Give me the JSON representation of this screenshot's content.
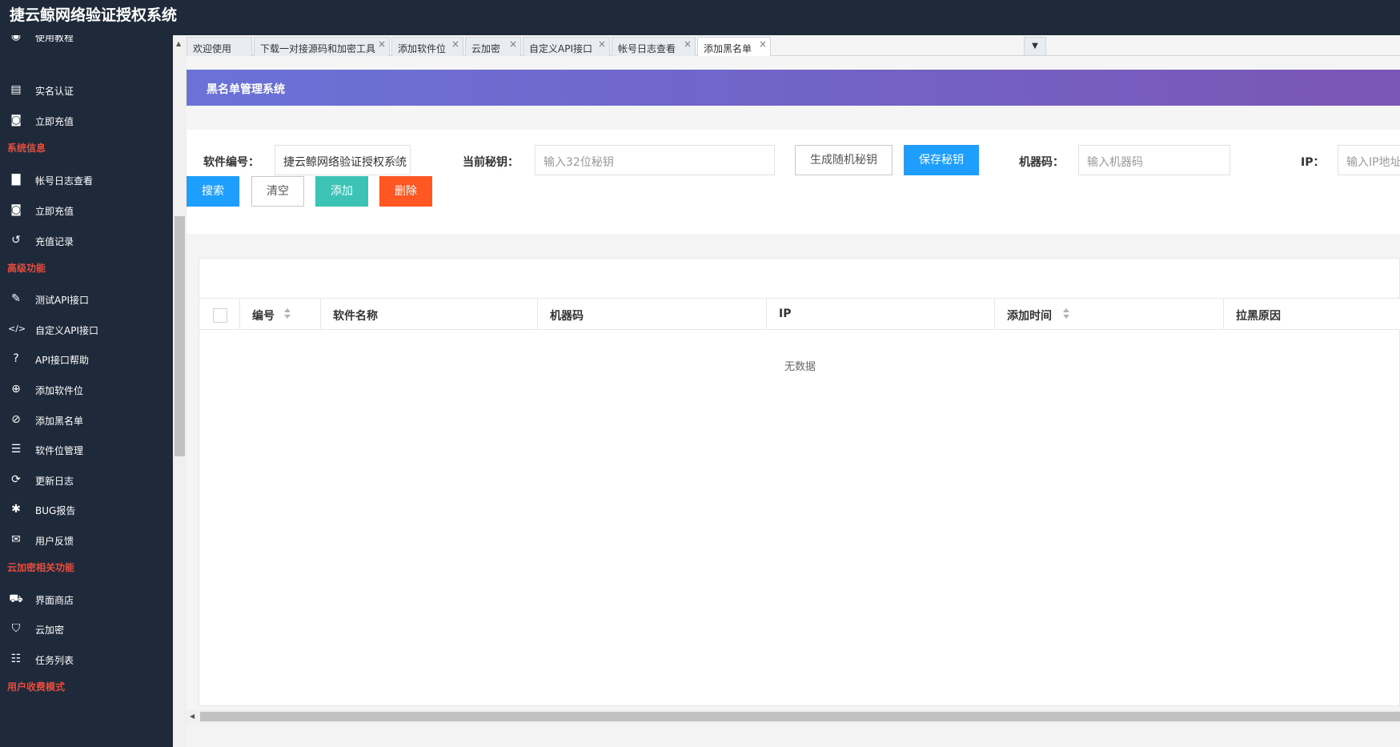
{
  "app": {
    "title": "捷云鲸网络验证授权系统"
  },
  "sidebar": {
    "partial_item": "使用教程",
    "items": [
      {
        "label": "实名认证",
        "icon": "id-card-icon",
        "glyph": "▤"
      },
      {
        "label": "立即充值",
        "icon": "money-icon",
        "glyph": "◙"
      },
      {
        "section": "系统信息"
      },
      {
        "label": "帐号日志查看",
        "icon": "file-icon",
        "glyph": "▇"
      },
      {
        "label": "立即充值",
        "icon": "money-icon",
        "glyph": "◙"
      },
      {
        "label": "充值记录",
        "icon": "history-icon",
        "glyph": "↺"
      },
      {
        "section": "高级功能"
      },
      {
        "label": "测试API接口",
        "icon": "plug-icon",
        "glyph": "✎"
      },
      {
        "label": "自定义API接口",
        "icon": "code-icon",
        "glyph": "</>"
      },
      {
        "label": "API接口帮助",
        "icon": "question-icon",
        "glyph": "?"
      },
      {
        "label": "添加软件位",
        "icon": "plus-circle-icon",
        "glyph": "⊕"
      },
      {
        "label": "添加黑名单",
        "icon": "ban-icon",
        "glyph": "⊘"
      },
      {
        "label": "软件位管理",
        "icon": "list-icon",
        "glyph": "☰"
      },
      {
        "label": "更新日志",
        "icon": "refresh-icon",
        "glyph": "⟳"
      },
      {
        "label": "BUG报告",
        "icon": "bug-icon",
        "glyph": "✱"
      },
      {
        "label": "用户反馈",
        "icon": "comments-icon",
        "glyph": "✉"
      },
      {
        "section": "云加密相关功能"
      },
      {
        "label": "界面商店",
        "icon": "cart-icon",
        "glyph": "⛟"
      },
      {
        "label": "云加密",
        "icon": "shield-icon",
        "glyph": "⛉"
      },
      {
        "label": "任务列表",
        "icon": "tasks-icon",
        "glyph": "☷"
      },
      {
        "section": "用户收费模式"
      }
    ]
  },
  "tabs": [
    {
      "label": "欢迎使用",
      "closable": false
    },
    {
      "label": "下载一对接源码和加密工具",
      "closable": true
    },
    {
      "label": "添加软件位",
      "closable": true
    },
    {
      "label": "云加密",
      "closable": true
    },
    {
      "label": "自定义API接口",
      "closable": true
    },
    {
      "label": "帐号日志查看",
      "closable": true
    },
    {
      "label": "添加黑名单",
      "closable": true,
      "active": true
    }
  ],
  "tab_more": "▼",
  "tab_close": "×",
  "banner": {
    "title": "黑名单管理系统"
  },
  "form": {
    "software_label": "软件编号：",
    "software_value": "捷云鲸网络验证授权系统",
    "key_label": "当前秘钥：",
    "key_placeholder": "输入32位秘钥",
    "gen_key_button": "生成随机秘钥",
    "save_key_button": "保存秘钥",
    "machine_label": "机器码：",
    "machine_placeholder": "输入机器码",
    "ip_label": "IP：",
    "ip_placeholder": "输入IP地址",
    "search_button": "搜索",
    "clear_button": "清空",
    "add_button": "添加",
    "delete_button": "删除"
  },
  "table": {
    "columns": [
      "编号",
      "软件名称",
      "机器码",
      "IP",
      "添加时间",
      "拉黑原因"
    ],
    "sortable": [
      true,
      false,
      false,
      false,
      true,
      false
    ],
    "empty_text": "无数据"
  },
  "colors": {
    "sidebar_bg": "#1e2a3a",
    "section_red": "#e84c3d",
    "banner_start": "#6a72d8",
    "banner_end": "#7a56b6",
    "blue": "#1e9fff",
    "teal": "#3cc3b5",
    "orange": "#ff5722"
  }
}
